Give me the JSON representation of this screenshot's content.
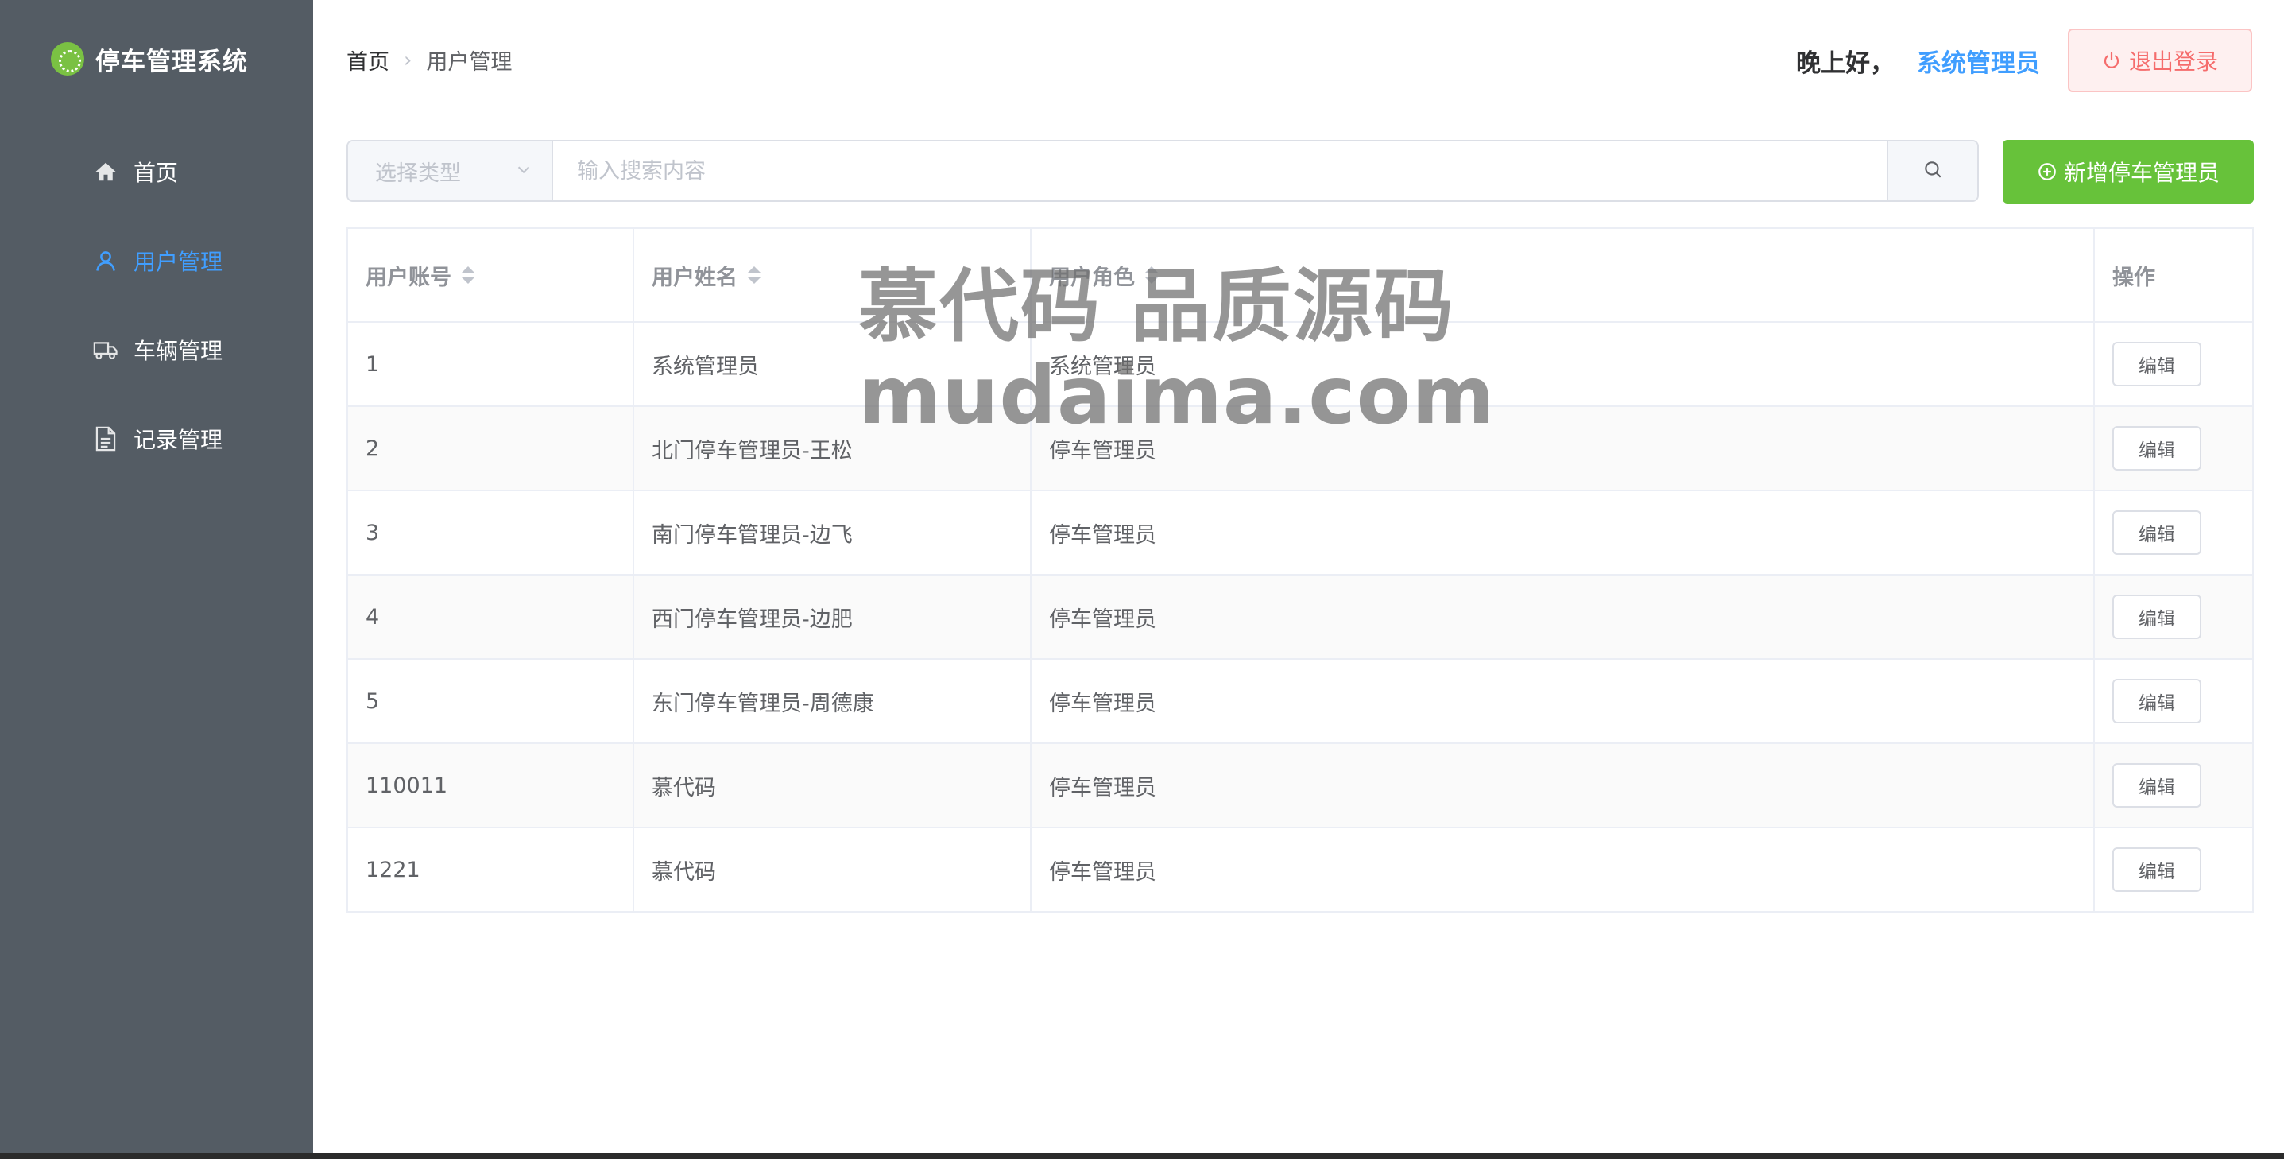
{
  "sidebar": {
    "brand_title": "停车管理系统",
    "items": [
      {
        "label": "首页",
        "icon": "home-icon",
        "active": false
      },
      {
        "label": "用户管理",
        "icon": "user-icon",
        "active": true
      },
      {
        "label": "车辆管理",
        "icon": "truck-icon",
        "active": false
      },
      {
        "label": "记录管理",
        "icon": "document-icon",
        "active": false
      }
    ]
  },
  "header": {
    "breadcrumb": [
      "首页",
      "用户管理"
    ],
    "greeting": "晚上好，",
    "username": "系统管理员",
    "logout_label": "退出登录"
  },
  "toolbar": {
    "type_placeholder": "选择类型",
    "search_placeholder": "输入搜索内容",
    "add_label": "新增停车管理员"
  },
  "table": {
    "columns": [
      "用户账号",
      "用户姓名",
      "用户角色",
      "操作"
    ],
    "rows": [
      {
        "account": "1",
        "name": "系统管理员",
        "role": "系统管理员",
        "action": "编辑"
      },
      {
        "account": "2",
        "name": "北门停车管理员-王松",
        "role": "停车管理员",
        "action": "编辑"
      },
      {
        "account": "3",
        "name": "南门停车管理员-边飞",
        "role": "停车管理员",
        "action": "编辑"
      },
      {
        "account": "4",
        "name": "西门停车管理员-边肥",
        "role": "停车管理员",
        "action": "编辑"
      },
      {
        "account": "5",
        "name": "东门停车管理员-周德康",
        "role": "停车管理员",
        "action": "编辑"
      },
      {
        "account": "110011",
        "name": "慕代码",
        "role": "停车管理员",
        "action": "编辑"
      },
      {
        "account": "1221",
        "name": "慕代码",
        "role": "停车管理员",
        "action": "编辑"
      }
    ]
  },
  "watermark": {
    "line1": "慕代码 品质源码",
    "line2": "mudaima.com"
  },
  "colors": {
    "sidebar_bg": "#545c64",
    "accent": "#409eff",
    "success": "#67c23a",
    "danger": "#f56c6c"
  }
}
